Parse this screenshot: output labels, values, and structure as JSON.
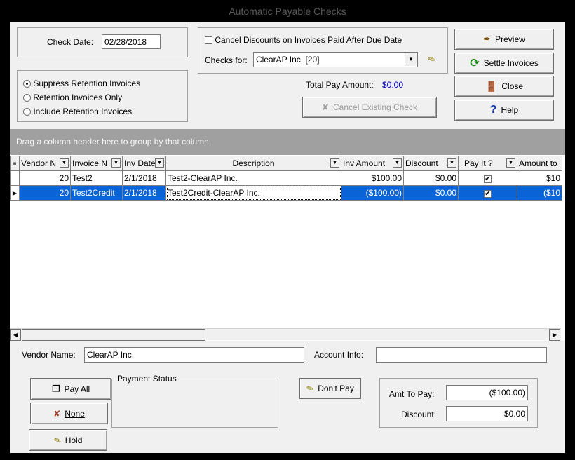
{
  "window": {
    "title": "Automatic Payable Checks"
  },
  "check_date": {
    "label": "Check Date:",
    "value": "02/28/2018"
  },
  "retention": {
    "options": [
      {
        "label": "Suppress Retention Invoices",
        "selected": true
      },
      {
        "label": "Retention Invoices Only",
        "selected": false
      },
      {
        "label": "Include Retention  Invoices",
        "selected": false
      }
    ]
  },
  "cancel_discounts": {
    "label": "Cancel Discounts on Invoices Paid After Due Date",
    "checked": false
  },
  "checks_for": {
    "label": "Checks for:",
    "value": "ClearAP Inc. [20]"
  },
  "total_pay": {
    "label": "Total Pay Amount:",
    "value": "$0.00"
  },
  "buttons": {
    "preview": "Preview",
    "settle": "Settle Invoices",
    "close": "Close",
    "help": "Help",
    "cancel_existing": "Cancel Existing Check",
    "pay_all": "Pay All",
    "none": "None",
    "hold": "Hold",
    "dont_pay": "Don't Pay"
  },
  "grid": {
    "group_panel_text": "Drag a column header here to group by that column",
    "columns": [
      "Vendor N",
      "Invoice N",
      "Inv Date",
      "Description",
      "Inv Amount",
      "Discount",
      "Pay It ?",
      "Amount to"
    ],
    "rows": [
      {
        "vendor": "20",
        "invoice": "Test2",
        "date": "2/1/2018",
        "description": "Test2-ClearAP Inc.",
        "amount": "$100.00",
        "discount": "$0.00",
        "pay": true,
        "amount_to": "$10",
        "selected": false
      },
      {
        "vendor": "20",
        "invoice": "Test2Credit",
        "date": "2/1/2018",
        "description": "Test2Credit-ClearAP Inc.",
        "amount": "($100.00)",
        "discount": "$0.00",
        "pay": true,
        "amount_to": "($10",
        "selected": true
      }
    ]
  },
  "vendor_name": {
    "label": "Vendor Name:",
    "value": "ClearAP Inc."
  },
  "account_info": {
    "label": "Account Info:",
    "value": ""
  },
  "payment_status": {
    "label": "Payment Status"
  },
  "amt_to_pay": {
    "label": "Amt To Pay:",
    "value": "($100.00)"
  },
  "discount": {
    "label": "Discount:",
    "value": "$0.00"
  },
  "colors": {
    "selection": "#0a64d8",
    "total_value": "#0000c0",
    "group_panel": "#a0a0a0"
  }
}
